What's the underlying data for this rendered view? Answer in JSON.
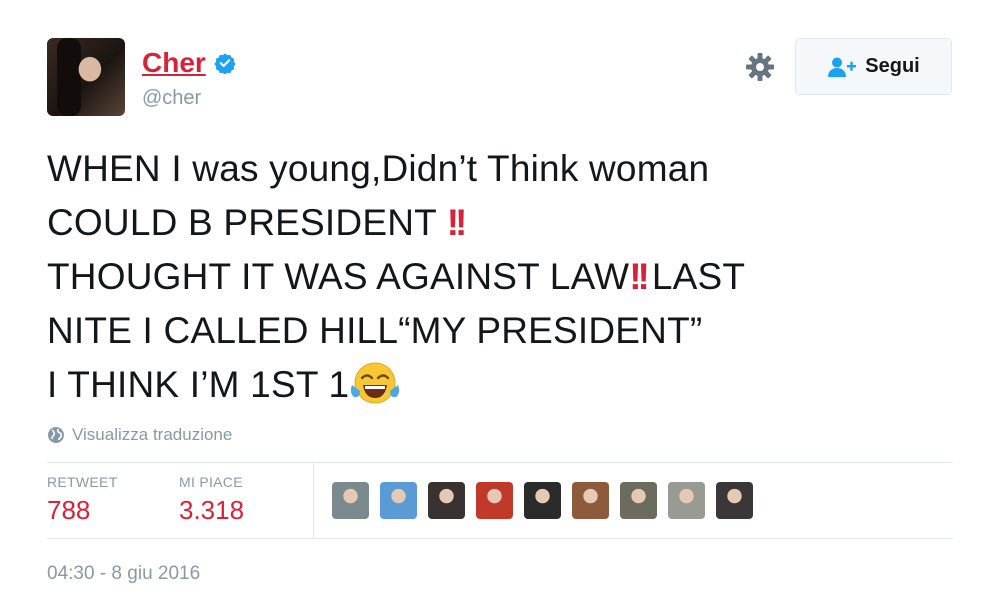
{
  "author": {
    "name": "Cher",
    "handle": "@cher",
    "verified": true
  },
  "header": {
    "follow_label": "Segui"
  },
  "tweet": {
    "line1": "WHEN I was young,Didn’t Think woman",
    "line2": "COULD B PRESIDENT",
    "line3": "THOUGHT IT WAS AGAINST LAW",
    "line3b": "LAST",
    "line4": "NITE I CALLED HILL“MY PRESIDENT”",
    "line5": "I THINK I’M 1ST 1",
    "emphasis": "!!"
  },
  "translate_label": "Visualizza traduzione",
  "stats": {
    "retweet_label": "RETWEET",
    "retweet_count": "788",
    "likes_label": "MI PIACE",
    "likes_count": "3.318"
  },
  "likers": [
    {
      "name": "liker-1",
      "color": "#7a8a8f"
    },
    {
      "name": "liker-2",
      "color": "#5b9bd5"
    },
    {
      "name": "liker-3",
      "color": "#3a3230"
    },
    {
      "name": "liker-4",
      "color": "#c0392b"
    },
    {
      "name": "liker-5",
      "color": "#2b2b2b"
    },
    {
      "name": "liker-6",
      "color": "#8e5a3c"
    },
    {
      "name": "liker-7",
      "color": "#6b6b5e"
    },
    {
      "name": "liker-8",
      "color": "#9a9a94"
    },
    {
      "name": "liker-9",
      "color": "#3b3638"
    }
  ],
  "timestamp": "04:30 - 8 giu 2016",
  "colors": {
    "accent": "#d6233a",
    "muted": "#8899a6",
    "verified": "#1da1f2"
  }
}
